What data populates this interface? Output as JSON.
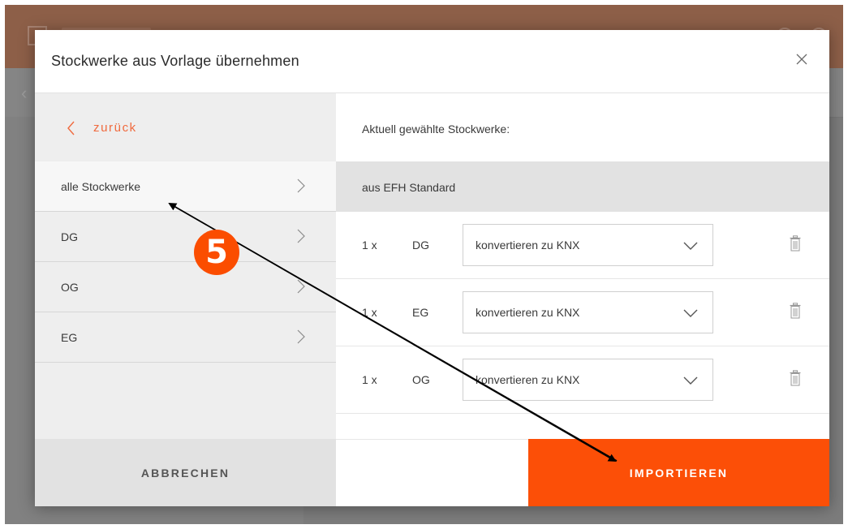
{
  "modal": {
    "title": "Stockwerke aus Vorlage übernehmen",
    "back_label": "zurück",
    "floors": [
      {
        "label": "alle Stockwerke",
        "active": true
      },
      {
        "label": "DG",
        "active": false
      },
      {
        "label": "OG",
        "active": false
      },
      {
        "label": "EG",
        "active": false
      }
    ],
    "current_label": "Aktuell gewählte Stockwerke:",
    "template_label": "aus EFH Standard",
    "rows": [
      {
        "qty": "1 x",
        "floor": "DG",
        "select_value": "konvertieren zu KNX"
      },
      {
        "qty": "1 x",
        "floor": "EG",
        "select_value": "konvertieren zu KNX"
      },
      {
        "qty": "1 x",
        "floor": "OG",
        "select_value": "konvertieren zu KNX"
      }
    ],
    "cancel_label": "ABBRECHEN",
    "import_label": "IMPORTIEREN"
  },
  "annotation": {
    "step_number": "5"
  },
  "icons": {
    "close": "close-icon",
    "back": "chevron-left-icon",
    "floor_nav": "chevron-right-icon",
    "dropdown": "chevron-down-icon",
    "delete": "trash-icon"
  },
  "colors": {
    "accent": "#fc4f07",
    "back_link": "#f06a3e",
    "app_header": "#8d5f48"
  }
}
